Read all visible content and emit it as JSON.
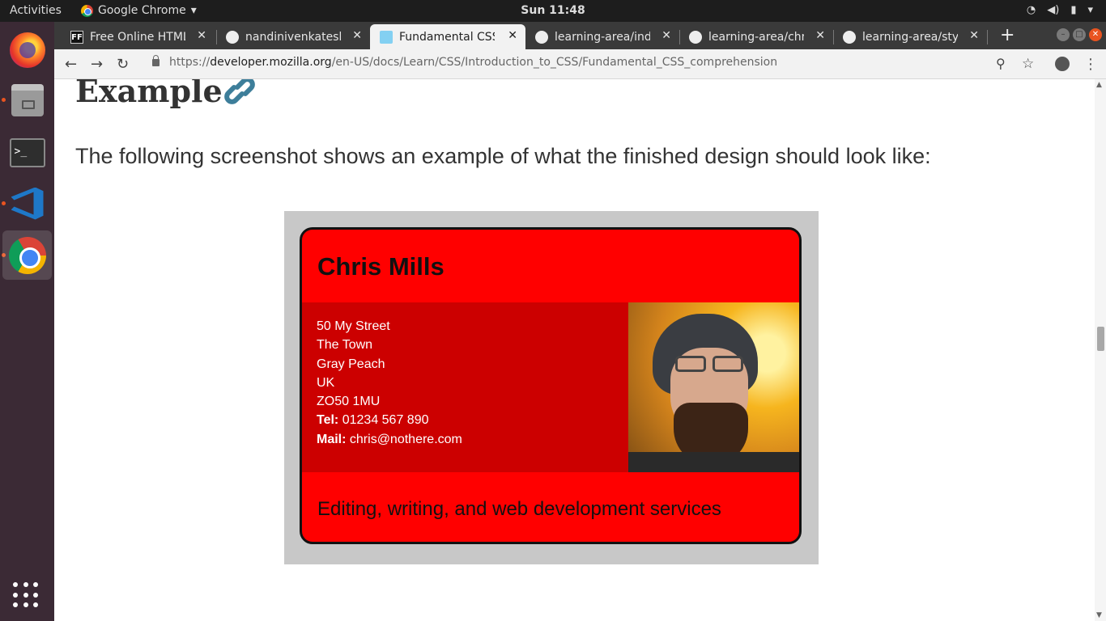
{
  "system": {
    "activities": "Activities",
    "app_name": "Google Chrome",
    "clock": "Sun 11:48"
  },
  "tabs": [
    {
      "title": "Free Online HTML",
      "favicon": "FF"
    },
    {
      "title": "nandinivenkatesh",
      "favicon": "github-icon"
    },
    {
      "title": "Fundamental CSS c",
      "favicon": "mdn-icon"
    },
    {
      "title": "learning-area/inde",
      "favicon": "github-icon"
    },
    {
      "title": "learning-area/chri",
      "favicon": "github-icon"
    },
    {
      "title": "learning-area/style",
      "favicon": "github-icon"
    }
  ],
  "address_bar": {
    "prefix": "https://",
    "host": "developer.mozilla.org",
    "path": "/en-US/docs/Learn/CSS/Introduction_to_CSS/Fundamental_CSS_comprehension"
  },
  "page": {
    "heading": "Example",
    "paragraph": "The following screenshot shows an example of what the finished design should look like:"
  },
  "card": {
    "name": "Chris Mills",
    "address": [
      "50 My Street",
      "The Town",
      "Gray Peach",
      "UK",
      "ZO50 1MU"
    ],
    "tel_label": "Tel:",
    "tel": "01234 567 890",
    "mail_label": "Mail:",
    "mail": "chris@nothere.com",
    "tagline": "Editing, writing, and web development services"
  },
  "colors": {
    "card_red": "#ff0000",
    "card_dark_red": "#cc0000",
    "dock_bg": "#3b2a35",
    "ubuntu_orange": "#e95420",
    "link_blue": "#3d7e9a"
  }
}
